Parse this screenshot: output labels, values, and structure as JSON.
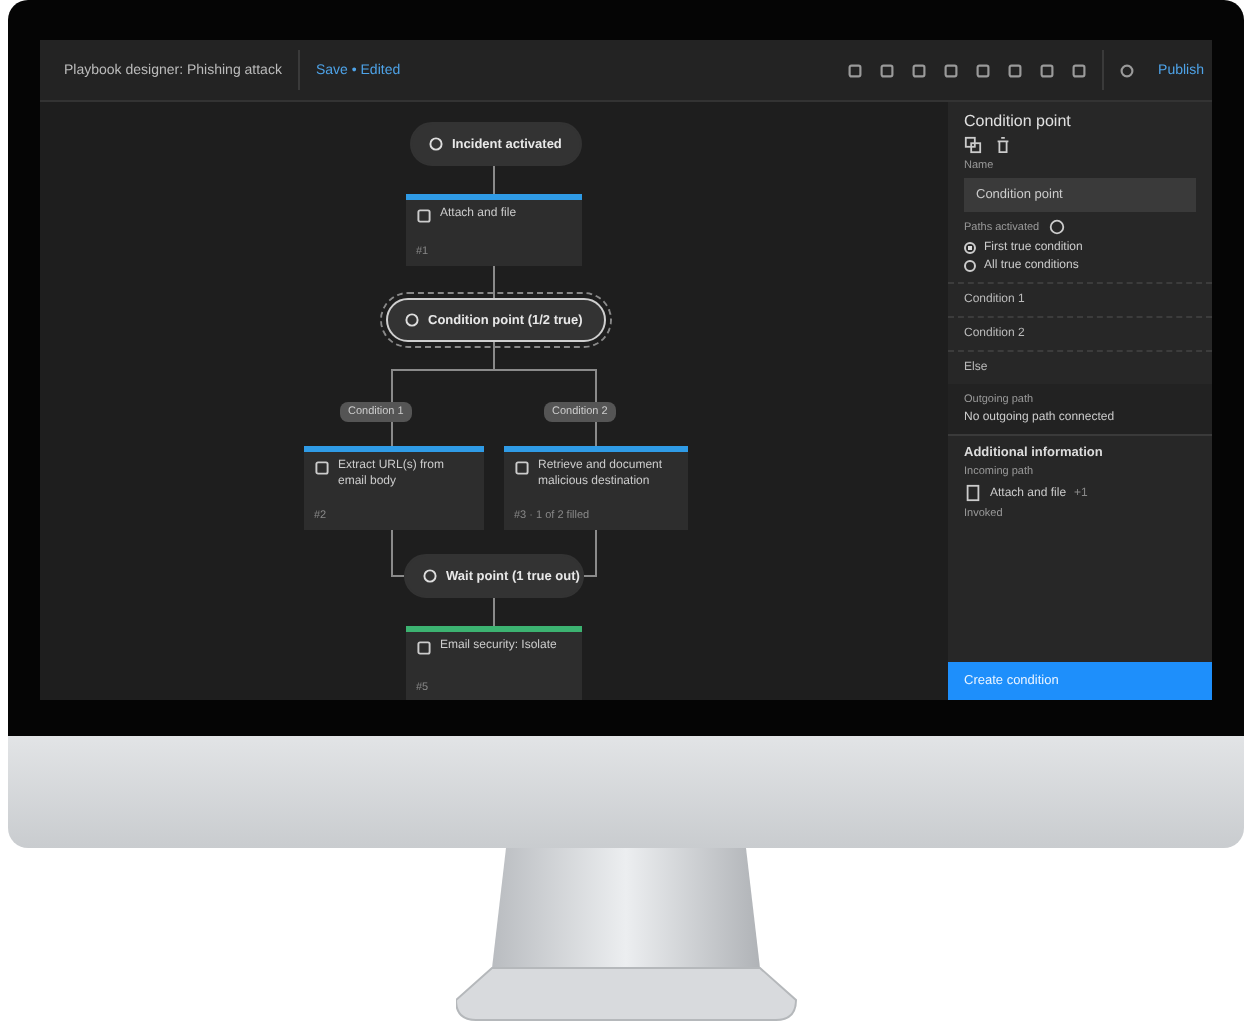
{
  "window": {
    "title": "Playbook designer: Phishing attack",
    "save_status": "Save • Edited",
    "publish": "Publish"
  },
  "nodes": [
    {
      "kind": "pill",
      "text": "Incident activated",
      "selected": false
    },
    {
      "kind": "card",
      "text": "Attach and file",
      "footer": "#1",
      "color": "#2f9be6"
    },
    {
      "kind": "pill",
      "text": "Condition point (1/2 true)",
      "selected": true
    },
    {
      "kind": "card",
      "text": "Extract URL(s) from email body",
      "footer": "#2",
      "color": "#2f9be6"
    },
    {
      "kind": "card",
      "text": "Retrieve and document malicious destination",
      "footer": "#3 · 1 of 2 filled",
      "color": "#2f9be6"
    },
    {
      "kind": "pill",
      "text": "Wait point (1 true out)",
      "selected": false
    },
    {
      "kind": "card",
      "text": "Email security: Isolate",
      "footer": "#5",
      "color": "#3cb371"
    }
  ],
  "branch_labels": [
    "Condition 1",
    "Condition 2"
  ],
  "panel": {
    "title": "Condition point",
    "name_label": "Name",
    "name_value": "Condition point",
    "paths_label": "Paths activated",
    "options": [
      {
        "label": "First true condition",
        "selected": true
      },
      {
        "label": "All true conditions",
        "selected": false
      }
    ],
    "conditions": [
      "Condition 1",
      "Condition 2",
      "Else"
    ],
    "outgoing_label": "Outgoing path",
    "outgoing_value": "No outgoing path connected",
    "section_title": "Additional information",
    "incoming_label": "Incoming path",
    "incoming_value": "Attach and file",
    "incoming_extra": "+1",
    "invoked_label": "Invoked",
    "button": "Create condition"
  }
}
